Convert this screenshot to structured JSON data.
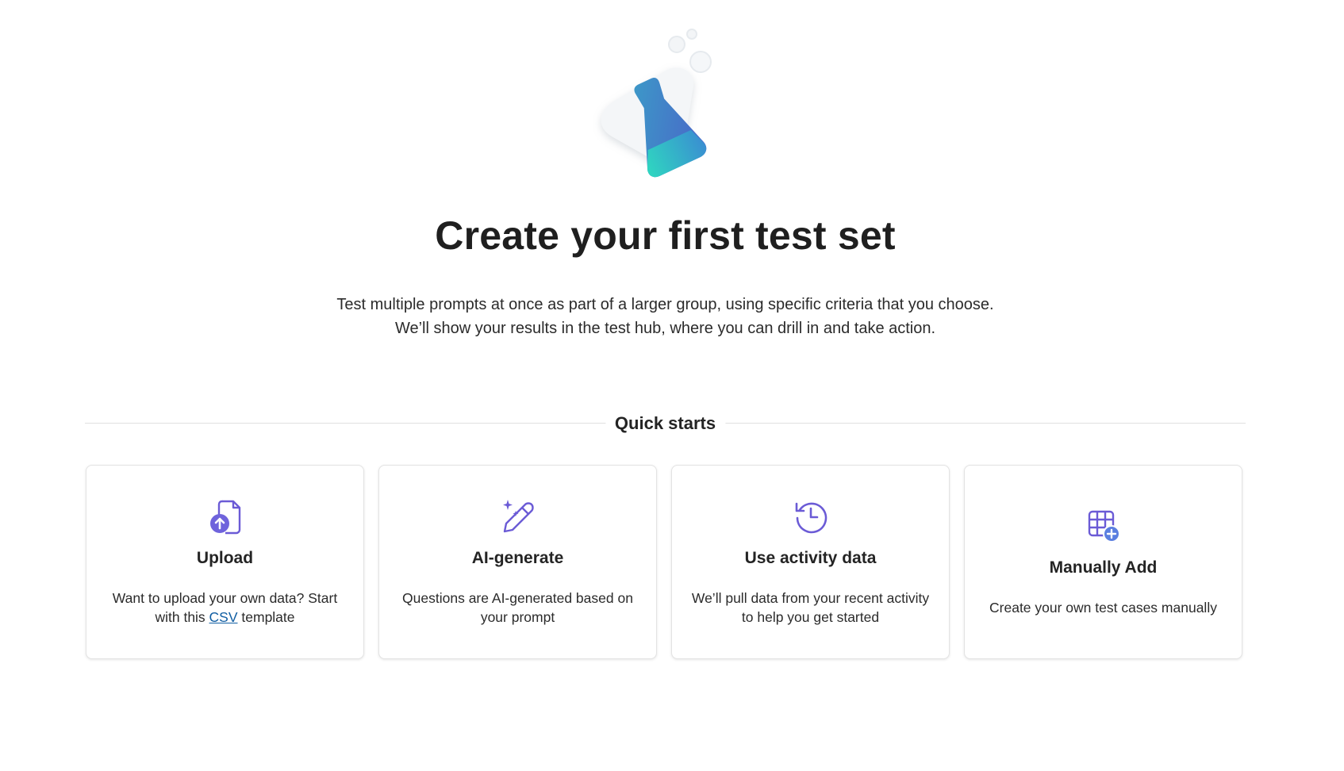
{
  "hero": {
    "illustration": "flask-icon"
  },
  "title": "Create your first test set",
  "description": {
    "line1": "Test multiple prompts at once as part of a larger group, using specific criteria that you choose.",
    "line2": "We’ll show your results in the test hub, where you can drill in and take action."
  },
  "quick_starts": {
    "label": "Quick starts",
    "cards": [
      {
        "icon": "upload-document-icon",
        "title": "Upload",
        "text_before": "Want to upload your own data? Start with this ",
        "link": "CSV",
        "text_after": " template"
      },
      {
        "icon": "ai-pen-sparkle-icon",
        "title": "AI-generate",
        "text": "Questions are AI-generated based on your prompt"
      },
      {
        "icon": "history-icon",
        "title": "Use activity data",
        "text": "We’ll pull data from your recent activity to help you get started"
      },
      {
        "icon": "table-add-icon",
        "title": "Manually Add",
        "text": "Create your own test cases manually"
      }
    ]
  },
  "colors": {
    "accent_purple": "#6b5bd6",
    "link": "#115ea3",
    "divider": "#e0e0e0"
  }
}
